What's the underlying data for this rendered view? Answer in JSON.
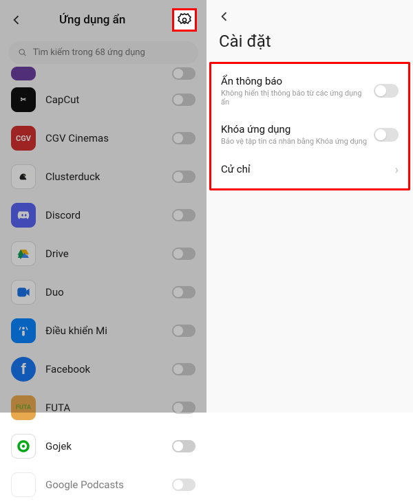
{
  "left": {
    "title": "Ứng dụng ẩn",
    "search_placeholder": "Tìm kiếm trong 68 ứng dụng",
    "apps": [
      {
        "name": "CapCut"
      },
      {
        "name": "CGV Cinemas"
      },
      {
        "name": "Clusterduck"
      },
      {
        "name": "Discord"
      },
      {
        "name": "Drive"
      },
      {
        "name": "Duo"
      },
      {
        "name": "Điều khiển Mi"
      },
      {
        "name": "Facebook"
      },
      {
        "name": "FUTA"
      },
      {
        "name": "Gojek"
      },
      {
        "name": "Google Podcasts"
      }
    ]
  },
  "right": {
    "title": "Cài đặt",
    "settings": [
      {
        "title": "Ẩn thông báo",
        "sub": "Không hiển thị thông báo từ các ứng dụng ẩn"
      },
      {
        "title": "Khóa ứng dụng",
        "sub": "Bảo vệ tập tin cá nhân bằng Khóa ứng dụng"
      },
      {
        "title": "Cử chỉ"
      }
    ]
  }
}
